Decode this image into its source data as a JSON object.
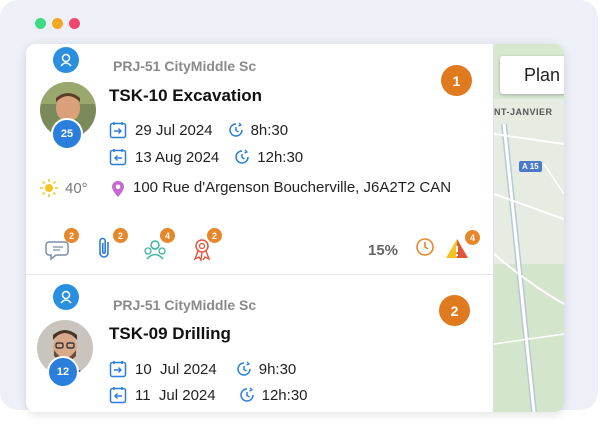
{
  "colors": {
    "window_dot_1": "#3ddc84",
    "window_dot_2": "#f5a623",
    "window_dot_3": "#f0466e",
    "accent_orange": "#e07a1f",
    "accent_blue": "#2b7fdc"
  },
  "map": {
    "plan_button_label": "Plan",
    "place_label": "NT-JANVIER",
    "highway_label": "A 15"
  },
  "tasks": [
    {
      "project": "PRJ-51 CityMiddle Sc",
      "title": "TSK-10 Excavation",
      "order": "1",
      "assignee_count": "25",
      "start_date": "29 Jul 2024",
      "start_time": "8h:30",
      "end_date": "13 Aug 2024",
      "end_time": "12h:30",
      "temperature": "40°",
      "address": "100 Rue d'Argenson Boucherville, J6A2T2 CAN",
      "actions": {
        "comments_count": "2",
        "attachments_count": "2",
        "team_count": "4",
        "certifications_count": "2",
        "progress": "15%",
        "alerts_count": "4"
      }
    },
    {
      "project": "PRJ-51 CityMiddle Sc",
      "title": "TSK-09 Drilling",
      "order": "2",
      "assignee_count": "12",
      "start_date": "10  Jul 2024",
      "start_time": "9h:30",
      "end_date": "11  Jul 2024",
      "end_time": "12h:30"
    }
  ]
}
